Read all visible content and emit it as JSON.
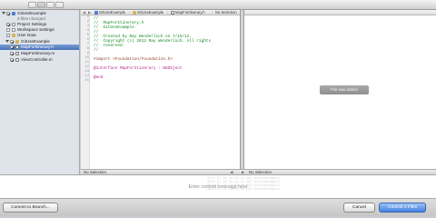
{
  "sidebar": {
    "project_name": "GitUseExample",
    "project_subtitle": "6 files changed",
    "items": [
      {
        "label": "Project Settings"
      },
      {
        "label": "Workspace Settings"
      },
      {
        "label": "User Data"
      },
      {
        "label": "GitUseExample"
      },
      {
        "label": "MapForItinerary.h"
      },
      {
        "label": "MapForItinerary.m"
      },
      {
        "label": "ViewController.m"
      }
    ]
  },
  "editor_left": {
    "jump": [
      "GitUseExample",
      "GitUseExample",
      "MapForItinerary.h",
      "No Selection"
    ],
    "line_numbers": [
      "1",
      "2",
      "3",
      "4",
      "5",
      "6",
      "7",
      "8",
      "9",
      "10",
      "11",
      "12",
      "13",
      "14",
      "15"
    ],
    "code_lines": [
      "//",
      "//  MapForItinerary.h",
      "//  GitUseExample",
      "//",
      "//  Created by Ray Wenderlich on 7/15/12.",
      "//  Copyright (c) 2012 Ray Wenderlich. All rights",
      "//  reserved.",
      "//",
      "",
      "#import <Foundation/Foundation.h>",
      "",
      "@interface MapForItinerary : NSObject",
      "",
      "@end"
    ],
    "status": "No Selection"
  },
  "editor_right": {
    "overlay": "File was added",
    "status": "No Selection"
  },
  "commit": {
    "placeholder": "Enter commit message here",
    "ghost_lines": [
      "2012-07-16 18:14:51.287 GitUseExample",
      "2012-07-16 18:14:51.287 GitUseExample",
      "2012-07-16 19:00:00.000 GitUseExample",
      "2012-07-16 19:00:00.000 GitUseExample"
    ]
  },
  "footer": {
    "commit_to_branch": "Commit to Branch...",
    "cancel": "Cancel",
    "commit_files": "Commit 4 Files"
  }
}
